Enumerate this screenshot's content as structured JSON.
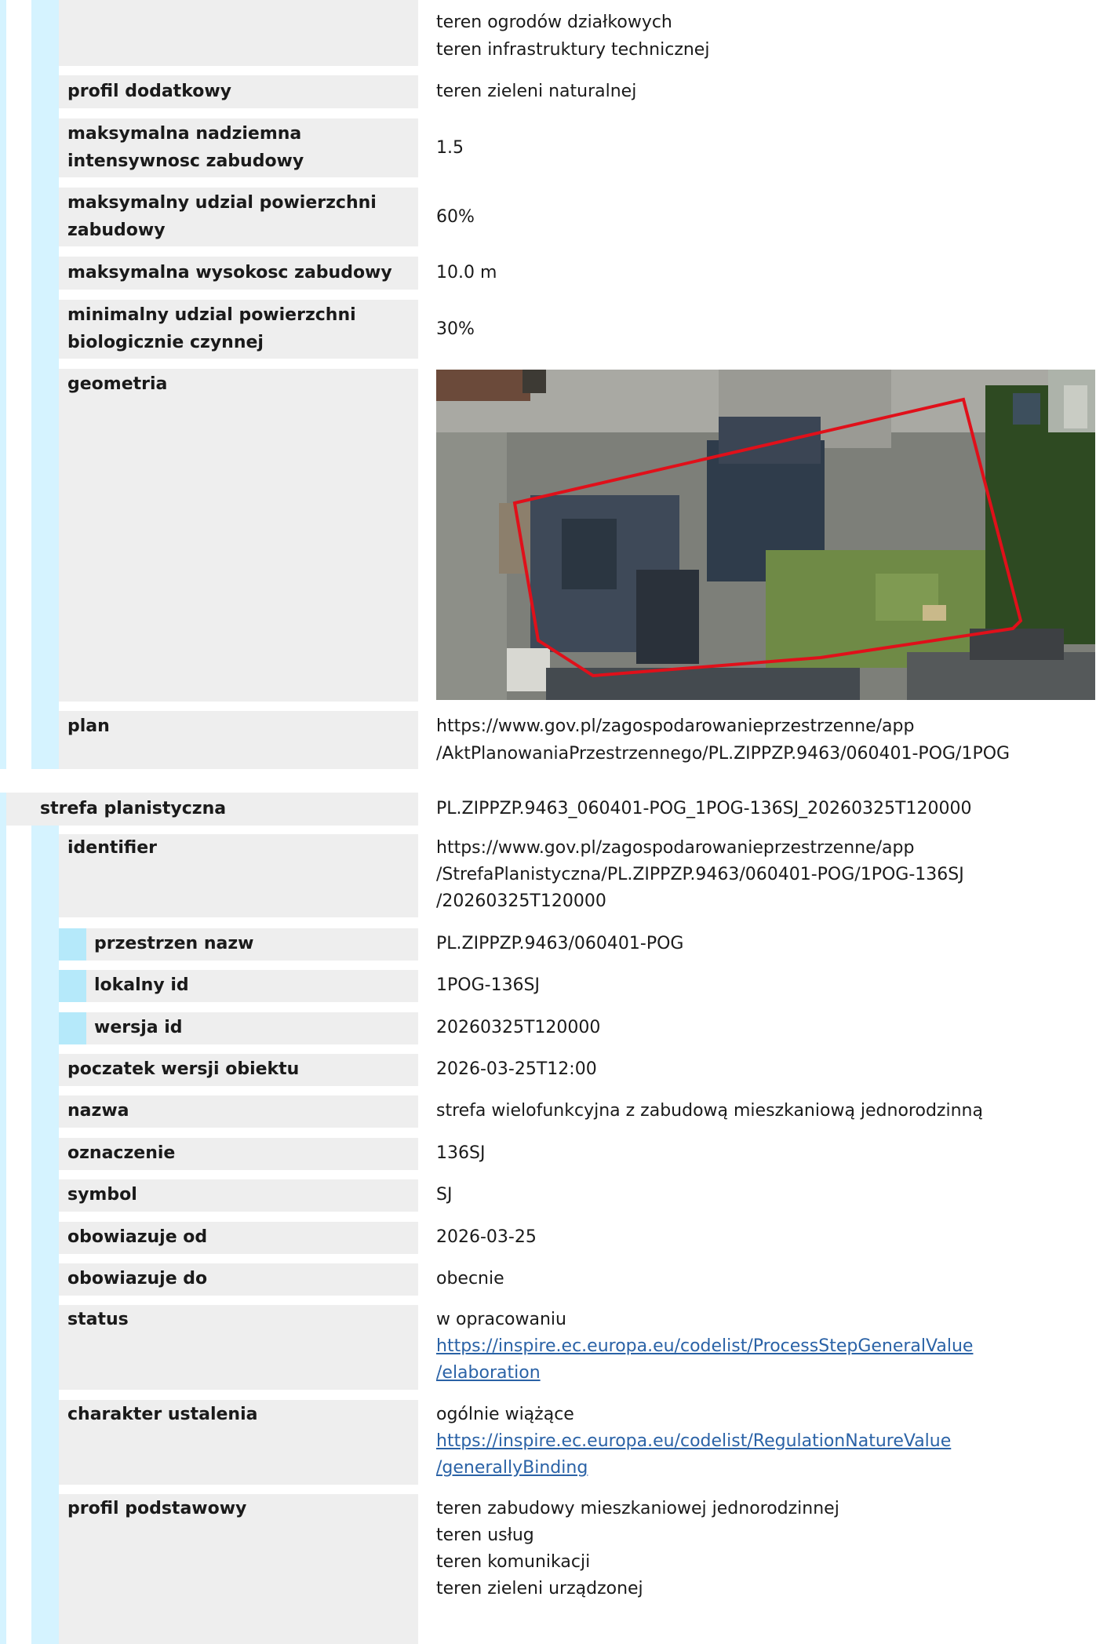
{
  "top_section": {
    "continued_values": [
      "teren ogrodów działkowych",
      "teren infrastruktury technicznej"
    ],
    "rows": [
      {
        "label": "profil dodatkowy",
        "value": "teren zieleni naturalnej"
      },
      {
        "label_lines": [
          "maksymalna nadziemna",
          "intensywnosc zabudowy"
        ],
        "value": "1.5"
      },
      {
        "label_lines": [
          "maksymalny udzial powierzchni",
          "zabudowy"
        ],
        "value": "60%"
      },
      {
        "label": "maksymalna wysokosc zabudowy",
        "value": "10.0 m"
      },
      {
        "label_lines": [
          "minimalny udzial powierzchni",
          "biologicznie czynnej"
        ],
        "value": "30%"
      }
    ],
    "geometria_label": "geometria",
    "plan": {
      "label": "plan",
      "value_lines": [
        "https://www.gov.pl/zagospodarowanieprzestrzenne/app",
        "/AktPlanowaniaPrzestrzennego/PL.ZIPPZP.9463/060401-POG/1POG"
      ]
    }
  },
  "strefa": {
    "label": "strefa planistyczna",
    "value": "PL.ZIPPZP.9463_060401-POG_1POG-136SJ_20260325T120000",
    "identifier": {
      "label": "identifier",
      "value_lines": [
        "https://www.gov.pl/zagospodarowanieprzestrzenne/app",
        "/StrefaPlanistyczna/PL.ZIPPZP.9463/060401-POG/1POG-136SJ",
        "/20260325T120000"
      ],
      "children": [
        {
          "label": "przestrzen nazw",
          "value": "PL.ZIPPZP.9463/060401-POG"
        },
        {
          "label": "lokalny id",
          "value": "1POG-136SJ"
        },
        {
          "label": "wersja id",
          "value": "20260325T120000"
        }
      ]
    },
    "rows": [
      {
        "label": "poczatek wersji obiektu",
        "value": "2026-03-25T12:00"
      },
      {
        "label": "nazwa",
        "value": "strefa wielofunkcyjna z zabudową mieszkaniową jednorodzinną"
      },
      {
        "label": "oznaczenie",
        "value": "136SJ"
      },
      {
        "label": "symbol",
        "value": "SJ"
      },
      {
        "label": "obowiazuje od",
        "value": "2026-03-25"
      },
      {
        "label": "obowiazuje do",
        "value": "obecnie"
      }
    ],
    "status": {
      "label": "status",
      "value": "w opracowaniu",
      "link_lines": [
        "https://inspire.ec.europa.eu/codelist/ProcessStepGeneralValue",
        "/elaboration"
      ]
    },
    "charakter": {
      "label": "charakter ustalenia",
      "value": "ogólnie wiążące",
      "link_lines": [
        "https://inspire.ec.europa.eu/codelist/RegulationNatureValue",
        "/generallyBinding"
      ]
    },
    "profil_podstawowy": {
      "label": "profil podstawowy",
      "values": [
        "teren zabudowy mieszkaniowej jednorodzinnej",
        "teren usług",
        "teren komunikacji",
        "teren zieleni urządzonej"
      ]
    }
  },
  "colors": {
    "label_bg": "#eeeeee",
    "indent_bar": "#d5f3ff",
    "indent_bar_deep": "#b5e9fa",
    "link": "#2a62a6",
    "outline": "#e0101a"
  }
}
